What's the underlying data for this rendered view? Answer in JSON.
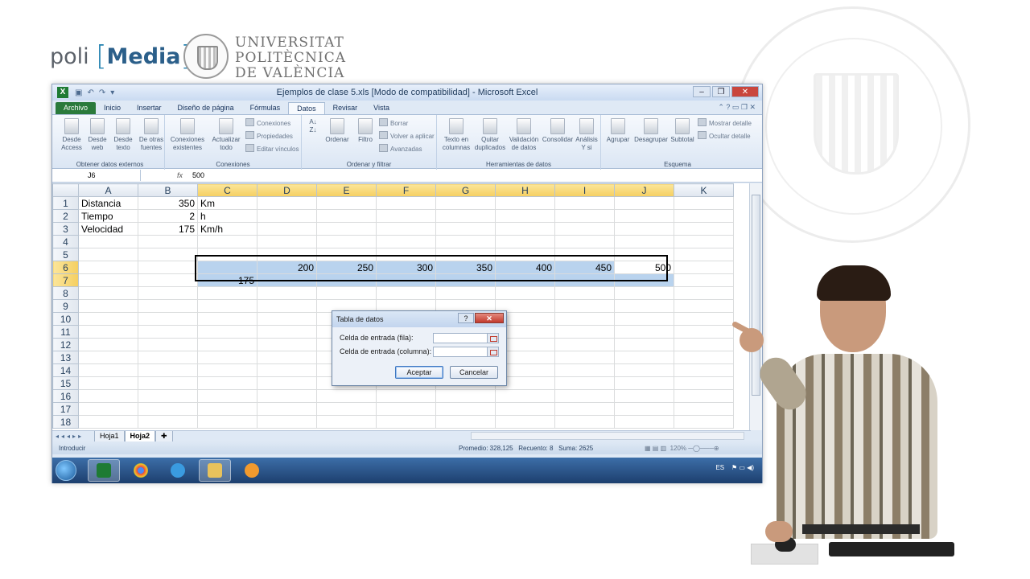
{
  "brand": {
    "poli": "poli",
    "media": "Media",
    "upv_lines": [
      "UNIVERSITAT",
      "POLITÈCNICA",
      "DE VALÈNCIA"
    ]
  },
  "window": {
    "title": "Ejemplos de clase 5.xls  [Modo de compatibilidad] - Microsoft Excel",
    "icon_letter": "X"
  },
  "ribbon_tabs": [
    "Archivo",
    "Inicio",
    "Insertar",
    "Diseño de página",
    "Fórmulas",
    "Datos",
    "Revisar",
    "Vista"
  ],
  "active_tab": "Datos",
  "ribbon": {
    "ext": {
      "label": "Obtener datos externos",
      "buttons": [
        "Desde Access",
        "Desde web",
        "Desde texto",
        "De otras fuentes"
      ]
    },
    "conn": {
      "label": "Conexiones",
      "existing": "Conexiones existentes",
      "refresh": "Actualizar todo",
      "small": [
        "Conexiones",
        "Propiedades",
        "Editar vínculos"
      ]
    },
    "sort": {
      "label": "Ordenar y filtrar",
      "sort": "Ordenar",
      "filter": "Filtro",
      "small": [
        "Borrar",
        "Volver a aplicar",
        "Avanzadas"
      ]
    },
    "tools": {
      "label": "Herramientas de datos",
      "buttons": [
        "Texto en columnas",
        "Quitar duplicados",
        "Validación de datos",
        "Consolidar",
        "Análisis Y si"
      ]
    },
    "outline": {
      "label": "Esquema",
      "buttons": [
        "Agrupar",
        "Desagrupar",
        "Subtotal"
      ],
      "small": [
        "Mostrar detalle",
        "Ocultar detalle"
      ]
    }
  },
  "formula_bar": {
    "name_box": "J6",
    "fx": "fx",
    "value": "500"
  },
  "columns": [
    "A",
    "B",
    "C",
    "D",
    "E",
    "F",
    "G",
    "H",
    "I",
    "J",
    "K"
  ],
  "rows": [
    {
      "n": "1",
      "A": "Distancia",
      "B": "350",
      "C": "Km"
    },
    {
      "n": "2",
      "A": "Tiempo",
      "B": "2",
      "C": "h"
    },
    {
      "n": "3",
      "A": "Velocidad",
      "B": "175",
      "C": "Km/h"
    },
    {
      "n": "4"
    },
    {
      "n": "5"
    },
    {
      "n": "6",
      "D": "200",
      "E": "250",
      "F": "300",
      "G": "350",
      "H": "400",
      "I": "450",
      "J": "500"
    },
    {
      "n": "7",
      "C": "175"
    },
    {
      "n": "8"
    },
    {
      "n": "9"
    },
    {
      "n": "10"
    },
    {
      "n": "11"
    },
    {
      "n": "12"
    },
    {
      "n": "13"
    },
    {
      "n": "14"
    },
    {
      "n": "15"
    },
    {
      "n": "16"
    },
    {
      "n": "17"
    },
    {
      "n": "18"
    }
  ],
  "sheets": [
    "Hoja1",
    "Hoja2"
  ],
  "active_sheet": "Hoja2",
  "status": {
    "mode": "Introducir",
    "average": "Promedio: 328,125",
    "count": "Recuento: 8",
    "sum": "Suma: 2625",
    "zoom": "120%"
  },
  "dialog": {
    "title": "Tabla de datos",
    "help": "?",
    "row_label": "Celda de entrada (fila):",
    "col_label": "Celda de entrada (columna):",
    "ok": "Aceptar",
    "cancel": "Cancelar"
  },
  "taskbar": {
    "lang": "ES"
  },
  "colors": {
    "excel_green": "#2a7a3b",
    "selection": "#b9d3ee",
    "header_sel": "#f5cf60"
  }
}
